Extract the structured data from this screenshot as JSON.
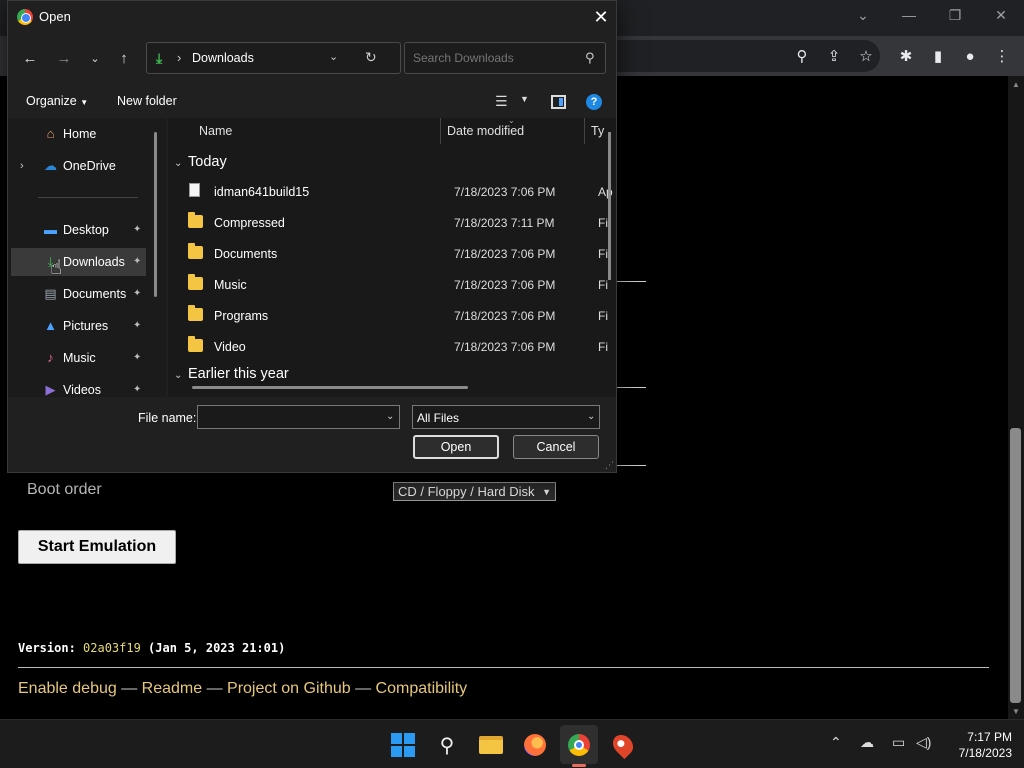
{
  "dialog": {
    "title": "Open",
    "address": "Downloads",
    "search_placeholder": "Search Downloads",
    "organize_label": "Organize",
    "new_folder_label": "New folder",
    "help_glyph": "?",
    "nav_items": [
      {
        "label": "Home",
        "icon": "home-icon"
      },
      {
        "label": "OneDrive",
        "icon": "cloud-icon"
      },
      {
        "label": "Desktop",
        "icon": "desktop-icon"
      },
      {
        "label": "Downloads",
        "icon": "download-icon",
        "selected": true
      },
      {
        "label": "Documents",
        "icon": "documents-icon"
      },
      {
        "label": "Pictures",
        "icon": "pictures-icon"
      },
      {
        "label": "Music",
        "icon": "music-icon"
      },
      {
        "label": "Videos",
        "icon": "videos-icon"
      }
    ],
    "columns": {
      "name": "Name",
      "date": "Date modified",
      "type": "Ty"
    },
    "groups": {
      "today": "Today",
      "earlier": "Earlier this year"
    },
    "files": [
      {
        "name": "idman641build15",
        "date": "7/18/2023 7:06 PM",
        "type": "Ap",
        "kind": "file"
      },
      {
        "name": "Compressed",
        "date": "7/18/2023 7:11 PM",
        "type": "Fi",
        "kind": "folder"
      },
      {
        "name": "Documents",
        "date": "7/18/2023 7:06 PM",
        "type": "Fi",
        "kind": "folder"
      },
      {
        "name": "Music",
        "date": "7/18/2023 7:06 PM",
        "type": "Fi",
        "kind": "folder"
      },
      {
        "name": "Programs",
        "date": "7/18/2023 7:06 PM",
        "type": "Fi",
        "kind": "folder"
      },
      {
        "name": "Video",
        "date": "7/18/2023 7:06 PM",
        "type": "Fi",
        "kind": "folder"
      }
    ],
    "file_name_label": "File name:",
    "file_name_value": "",
    "filter": "All Files",
    "open_label": "Open",
    "cancel_label": "Cancel"
  },
  "page": {
    "boot_label": "Boot order",
    "boot_value": "CD / Floppy / Hard Disk",
    "start_label": "Start Emulation",
    "version_prefix": "Version: ",
    "version_hash": "02a03f19",
    "version_suffix": " (Jan 5, 2023 21:01)",
    "links": [
      "Enable debug",
      "Readme",
      "Project on Github",
      "Compatibility"
    ],
    "link_separator": " — "
  },
  "taskbar": {
    "time": "7:17 PM",
    "date": "7/18/2023"
  },
  "colors": {
    "accent": "#2b9af3",
    "folder": "#f4c542",
    "link": "#e6c77b",
    "version_hash": "#e6db74"
  }
}
